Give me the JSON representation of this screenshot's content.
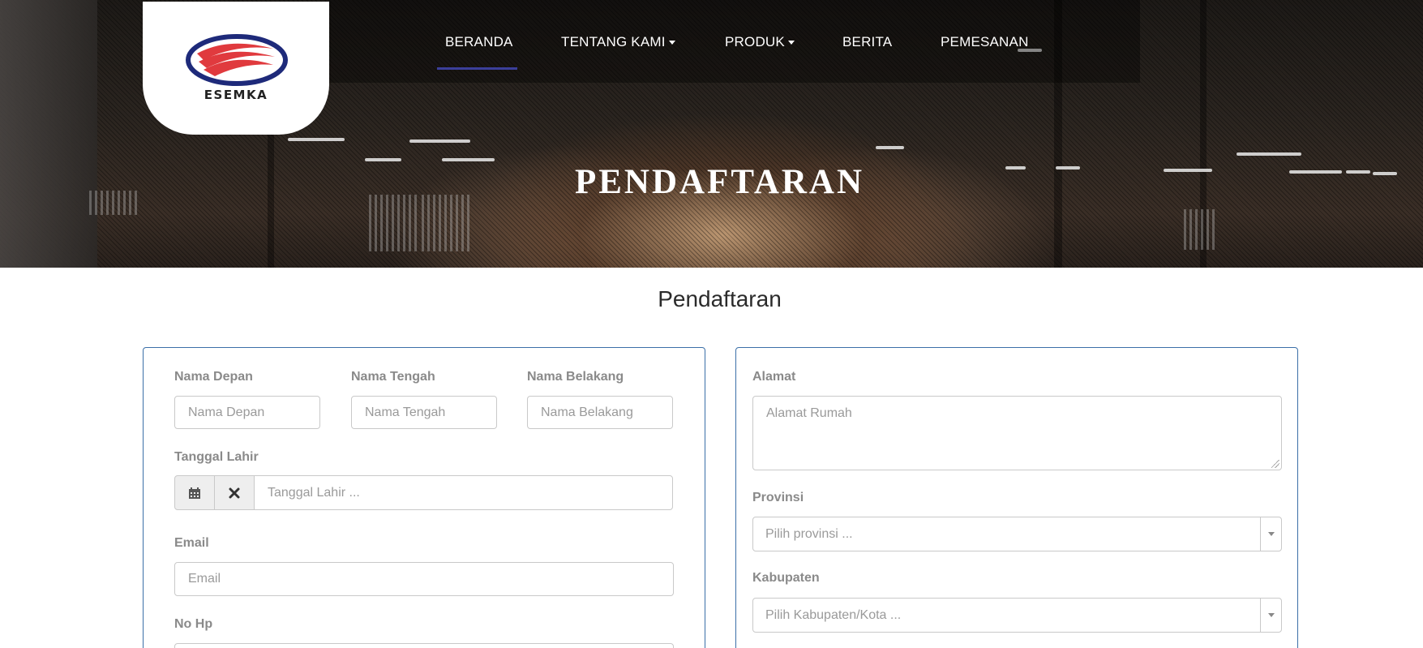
{
  "brand": {
    "logo_text": "ESEMKA"
  },
  "nav": {
    "items": [
      {
        "label": "BERANDA",
        "has_dropdown": false,
        "active": true
      },
      {
        "label": "TENTANG KAMI",
        "has_dropdown": true,
        "active": false
      },
      {
        "label": "PRODUK",
        "has_dropdown": true,
        "active": false
      },
      {
        "label": "BERITA",
        "has_dropdown": false,
        "active": false
      },
      {
        "label": "PEMESANAN",
        "has_dropdown": false,
        "active": false
      }
    ],
    "active_color": "#3b3f9a"
  },
  "hero": {
    "title": "PENDAFTARAN"
  },
  "page": {
    "heading": "Pendaftaran"
  },
  "form_left": {
    "first_name": {
      "label": "Nama Depan",
      "placeholder": "Nama Depan"
    },
    "middle_name": {
      "label": "Nama Tengah",
      "placeholder": "Nama Tengah"
    },
    "last_name": {
      "label": "Nama Belakang",
      "placeholder": "Nama Belakang"
    },
    "birth_date": {
      "label": "Tanggal Lahir",
      "placeholder": "Tanggal Lahir ...",
      "calendar_icon": "calendar-icon",
      "clear_icon": "times-icon"
    },
    "email": {
      "label": "Email",
      "placeholder": "Email"
    },
    "phone": {
      "label": "No Hp"
    }
  },
  "form_right": {
    "address": {
      "label": "Alamat",
      "placeholder": "Alamat Rumah"
    },
    "province": {
      "label": "Provinsi",
      "placeholder": "Pilih provinsi ..."
    },
    "regency": {
      "label": "Kabupaten",
      "placeholder": "Pilih Kabupaten/Kota ..."
    }
  },
  "colors": {
    "panel_border": "#3b6fa8",
    "label": "#8a8a8a"
  }
}
